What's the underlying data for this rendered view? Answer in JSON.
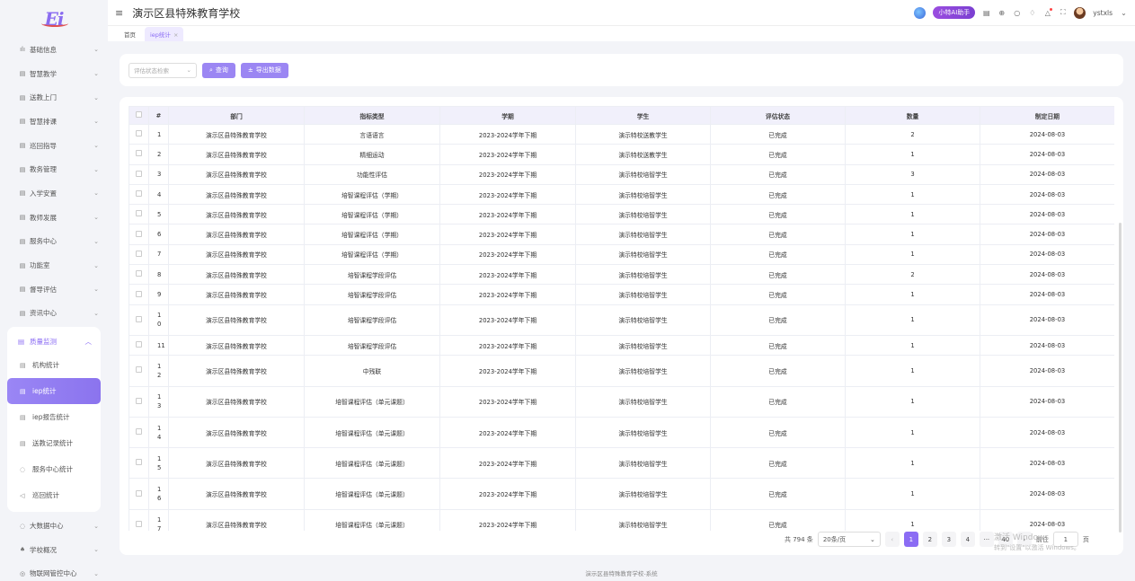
{
  "app": {
    "logo_text": "Ei",
    "title": "演示区县特殊教育学校",
    "ai_button": "小特AI助手",
    "username": "ystxls",
    "footer": "演示区县特殊教育学校-系统"
  },
  "tabs": [
    {
      "label": "首页"
    },
    {
      "label": "iep统计"
    }
  ],
  "sidebar": {
    "items_top": [
      {
        "label": "基础信息"
      },
      {
        "label": "智慧教学"
      },
      {
        "label": "送教上门"
      },
      {
        "label": "智慧排课"
      },
      {
        "label": "巡回指导"
      },
      {
        "label": "教务管理"
      },
      {
        "label": "入学安置"
      },
      {
        "label": "教师发展"
      },
      {
        "label": "服务中心"
      },
      {
        "label": "功能室"
      },
      {
        "label": "督导评估"
      },
      {
        "label": "资讯中心"
      }
    ],
    "expanded": {
      "label": "质量监测",
      "children": [
        {
          "label": "机构统计"
        },
        {
          "label": "iep统计"
        },
        {
          "label": "iep报告统计"
        },
        {
          "label": "送教记录统计"
        },
        {
          "label": "服务中心统计"
        },
        {
          "label": "巡回统计"
        }
      ]
    },
    "items_bottom": [
      {
        "label": "大数据中心"
      },
      {
        "label": "学校概况"
      },
      {
        "label": "物联网管控中心"
      }
    ]
  },
  "search": {
    "placeholder": "评估状态检索",
    "query_label": "查询",
    "export_label": "导出数据"
  },
  "table": {
    "headers": [
      "#",
      "部门",
      "指标类型",
      "学期",
      "学生",
      "评估状态",
      "数量",
      "制定日期"
    ],
    "rows": [
      {
        "idx": "1",
        "dept": "演示区县特殊教育学校",
        "type": "言语语言",
        "term": "2023-2024学年下期",
        "student": "演示特校送教学生",
        "status": "已完成",
        "count": "2",
        "date": "2024-08-03"
      },
      {
        "idx": "2",
        "dept": "演示区县特殊教育学校",
        "type": "精细运动",
        "term": "2023-2024学年下期",
        "student": "演示特校送教学生",
        "status": "已完成",
        "count": "1",
        "date": "2024-08-03"
      },
      {
        "idx": "3",
        "dept": "演示区县特殊教育学校",
        "type": "功能性评估",
        "term": "2023-2024学年下期",
        "student": "演示特校培智学生",
        "status": "已完成",
        "count": "3",
        "date": "2024-08-03"
      },
      {
        "idx": "4",
        "dept": "演示区县特殊教育学校",
        "type": "培智课程评估（学期）",
        "term": "2023-2024学年下期",
        "student": "演示特校培智学生",
        "status": "已完成",
        "count": "1",
        "date": "2024-08-03"
      },
      {
        "idx": "5",
        "dept": "演示区县特殊教育学校",
        "type": "培智课程评估（学期）",
        "term": "2023-2024学年下期",
        "student": "演示特校培智学生",
        "status": "已完成",
        "count": "1",
        "date": "2024-08-03"
      },
      {
        "idx": "6",
        "dept": "演示区县特殊教育学校",
        "type": "培智课程评估（学期）",
        "term": "2023-2024学年下期",
        "student": "演示特校培智学生",
        "status": "已完成",
        "count": "1",
        "date": "2024-08-03"
      },
      {
        "idx": "7",
        "dept": "演示区县特殊教育学校",
        "type": "培智课程评估（学期）",
        "term": "2023-2024学年下期",
        "student": "演示特校培智学生",
        "status": "已完成",
        "count": "1",
        "date": "2024-08-03"
      },
      {
        "idx": "8",
        "dept": "演示区县特殊教育学校",
        "type": "培智课程学段评估",
        "term": "2023-2024学年下期",
        "student": "演示特校培智学生",
        "status": "已完成",
        "count": "2",
        "date": "2024-08-03"
      },
      {
        "idx": "9",
        "dept": "演示区县特殊教育学校",
        "type": "培智课程学段评估",
        "term": "2023-2024学年下期",
        "student": "演示特校培智学生",
        "status": "已完成",
        "count": "1",
        "date": "2024-08-03"
      },
      {
        "idx": "10",
        "dept": "演示区县特殊教育学校",
        "type": "培智课程学段评估",
        "term": "2023-2024学年下期",
        "student": "演示特校培智学生",
        "status": "已完成",
        "count": "1",
        "date": "2024-08-03"
      },
      {
        "idx": "11",
        "dept": "演示区县特殊教育学校",
        "type": "培智课程学段评估",
        "term": "2023-2024学年下期",
        "student": "演示特校培智学生",
        "status": "已完成",
        "count": "1",
        "date": "2024-08-03"
      },
      {
        "idx": "12",
        "dept": "演示区县特殊教育学校",
        "type": "中残联",
        "term": "2023-2024学年下期",
        "student": "演示特校培智学生",
        "status": "已完成",
        "count": "1",
        "date": "2024-08-03"
      },
      {
        "idx": "13",
        "dept": "演示区县特殊教育学校",
        "type": "培智课程评估（单元课题）",
        "term": "2023-2024学年下期",
        "student": "演示特校培智学生",
        "status": "已完成",
        "count": "1",
        "date": "2024-08-03"
      },
      {
        "idx": "14",
        "dept": "演示区县特殊教育学校",
        "type": "培智课程评估（单元课题）",
        "term": "2023-2024学年下期",
        "student": "演示特校培智学生",
        "status": "已完成",
        "count": "1",
        "date": "2024-08-03"
      },
      {
        "idx": "15",
        "dept": "演示区县特殊教育学校",
        "type": "培智课程评估（单元课题）",
        "term": "2023-2024学年下期",
        "student": "演示特校培智学生",
        "status": "已完成",
        "count": "1",
        "date": "2024-08-03"
      },
      {
        "idx": "16",
        "dept": "演示区县特殊教育学校",
        "type": "培智课程评估（单元课题）",
        "term": "2023-2024学年下期",
        "student": "演示特校培智学生",
        "status": "已完成",
        "count": "1",
        "date": "2024-08-03"
      },
      {
        "idx": "17",
        "dept": "演示区县特殊教育学校",
        "type": "培智课程评估（单元课题）",
        "term": "2023-2024学年下期",
        "student": "演示特校培智学生",
        "status": "已完成",
        "count": "1",
        "date": "2024-08-03"
      }
    ]
  },
  "pagination": {
    "total_text": "共 794 条",
    "page_size": "20条/页",
    "pages": [
      "1",
      "2",
      "3",
      "4"
    ],
    "more": "···",
    "last_page": "40",
    "goto_label": "前往",
    "goto_value": "1",
    "page_suffix": "页"
  },
  "watermark": {
    "line1": "激活 Windows",
    "line2": "转到\"设置\"以激活 Windows。"
  }
}
